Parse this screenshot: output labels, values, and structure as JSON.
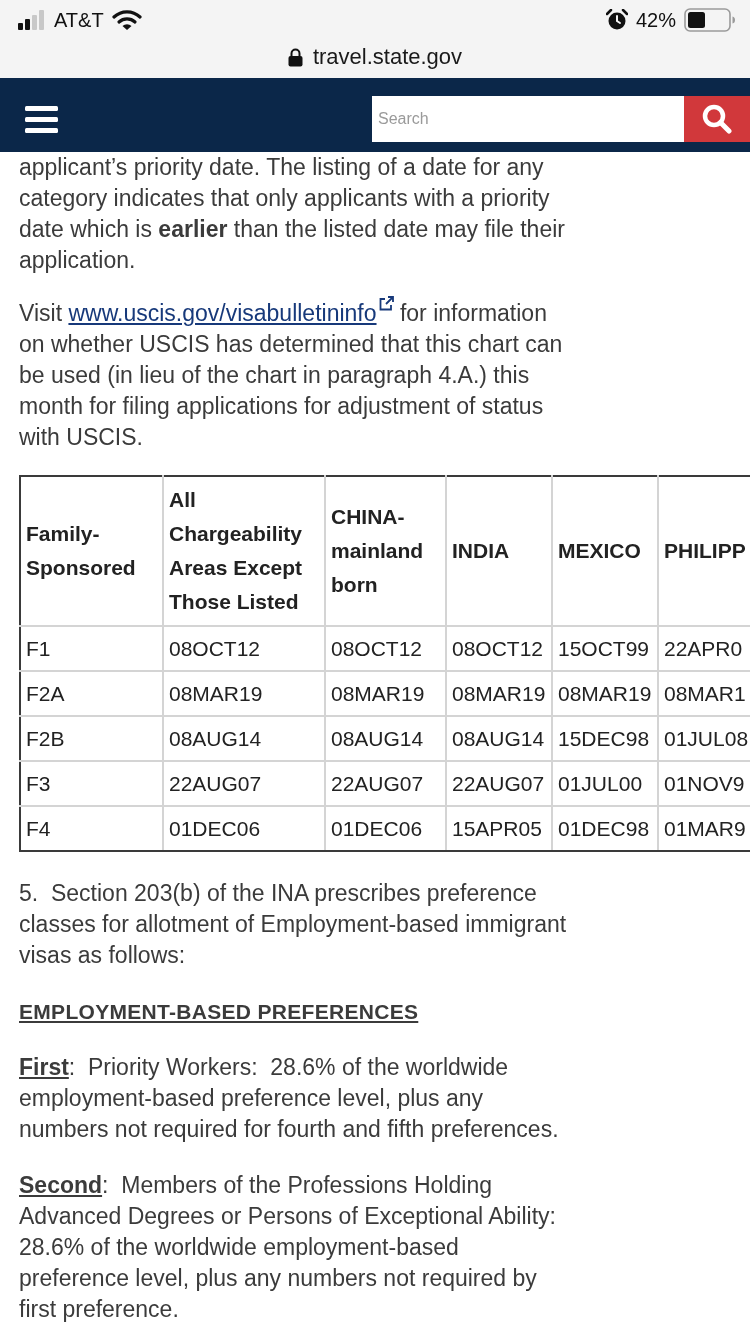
{
  "status_bar": {
    "carrier": "AT&T",
    "battery": "42%"
  },
  "address_bar": {
    "url": "travel.state.gov"
  },
  "nav": {
    "search": {
      "placeholder": "Search"
    }
  },
  "intro": [
    {
      "kind": "text",
      "text": "applicant’s priority date. The listing of a date for any category indicates that only applicants with a priority date which is **earlier** than the listed date may file their application."
    },
    {
      "kind": "link",
      "before": "Visit",
      "link": "www.uscis.gov/visabulletininfo",
      "after": "for information on whether USCIS has determined that this chart can be used (in lieu of the chart in paragraph 4.A.) this month for filing applications for adjustment of status with USCIS."
    }
  ],
  "table": {
    "columns": [
      "Family-Sponsored",
      "All Chargeability Areas Except Those Listed",
      "CHINA-mainland born",
      "INDIA",
      "MEXICO",
      "PHILIPP"
    ],
    "rows": [
      {
        "cells": [
          "F1",
          "08OCT12",
          "08OCT12",
          "08OCT12",
          "15OCT99",
          "22APR0"
        ]
      },
      {
        "cells": [
          "F2A",
          "08MAR19",
          "08MAR19",
          "08MAR19",
          "08MAR19",
          "08MAR1"
        ]
      },
      {
        "cells": [
          "F2B",
          "08AUG14",
          "08AUG14",
          "08AUG14",
          "15DEC98",
          "01JUL08"
        ]
      },
      {
        "cells": [
          "F3",
          "22AUG07",
          "22AUG07",
          "22AUG07",
          "01JUL00",
          "01NOV9"
        ]
      },
      {
        "cells": [
          "F4",
          "01DEC06",
          "01DEC06",
          "15APR05",
          "01DEC98",
          "01MAR9"
        ]
      }
    ]
  },
  "section": {
    "paragraph": "5.  Section 203(b) of the INA prescribes preference classes for allotment of Employment-based immigrant visas as follows:",
    "heading": "EMPLOYMENT-BASED PREFERENCES",
    "preferences": [
      {
        "term": "First",
        "text": ":  Priority Workers:  28.6% of the worldwide employment-based preference level, plus any numbers not required for fourth and fifth preferences."
      },
      {
        "term": "Second",
        "text": ":  Members of the Professions Holding Advanced Degrees or Persons of Exceptional Ability:  28.6% of the worldwide employment-based preference level, plus any numbers not required by first preference."
      }
    ]
  }
}
